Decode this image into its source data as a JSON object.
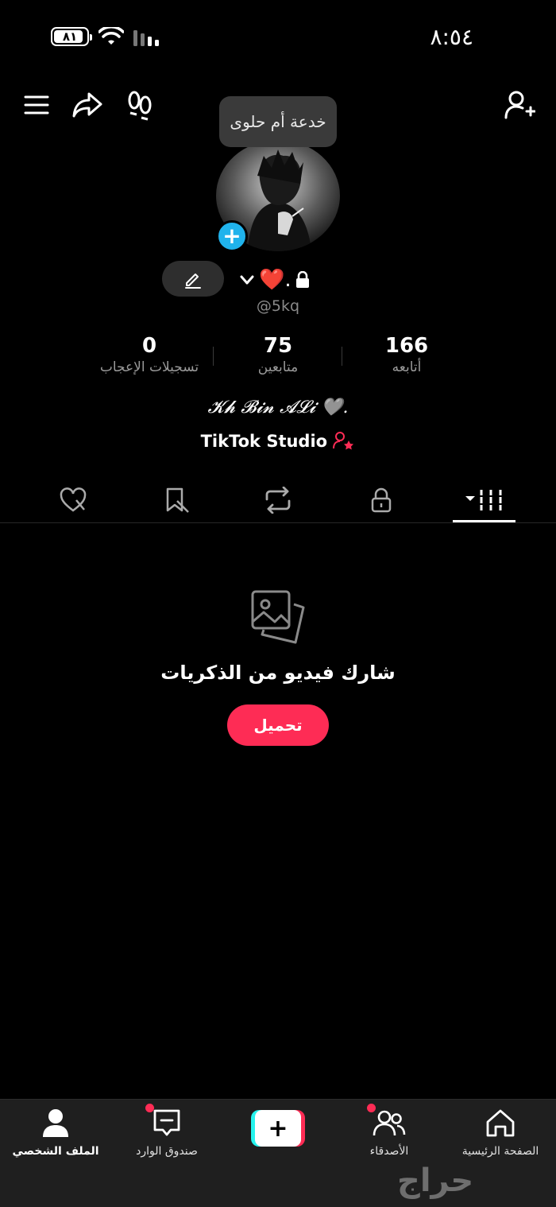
{
  "status_bar": {
    "battery_level": "٨١",
    "time": "٨:٥٤"
  },
  "header": {
    "menu_icon": "hamburger-menu-icon",
    "share_icon": "share-arrow-icon",
    "footprints_icon": "footprints-icon",
    "add_friend_icon": "add-user-icon"
  },
  "profile": {
    "tooltip": "خدعة أم حلوى",
    "name": "❤️.",
    "handle": "@5kq",
    "bio": "𝓚𝓱 𝓑𝓲𝓷 𝓐𝓛𝓲 🩶.",
    "studio_link": "TikTok Studio"
  },
  "stats": [
    {
      "value": "166",
      "label": "أتابعه"
    },
    {
      "value": "75",
      "label": "متابعين"
    },
    {
      "value": "0",
      "label": "تسجيلات الإعجاب"
    }
  ],
  "tabs": [
    {
      "name": "videos",
      "icon": "grid-icon"
    },
    {
      "name": "private",
      "icon": "lock-icon"
    },
    {
      "name": "reposts",
      "icon": "repost-icon"
    },
    {
      "name": "favorites",
      "icon": "bookmark-icon"
    },
    {
      "name": "liked",
      "icon": "heart-icon"
    }
  ],
  "empty_state": {
    "icon": "photo-stack-icon",
    "title": "شارك فيديو من الذكريات",
    "button": "تحميل"
  },
  "bottom_nav": {
    "home": "الصفحة الرئيسية",
    "friends": "الأصدقاء",
    "inbox": "صندوق الوارد",
    "profile": "الملف الشخصي"
  },
  "watermark": "حراج",
  "colors": {
    "accent": "#fe2c55",
    "cyan": "#25f4ee",
    "avatar_plus": "#20b3ec",
    "background": "#000000"
  }
}
